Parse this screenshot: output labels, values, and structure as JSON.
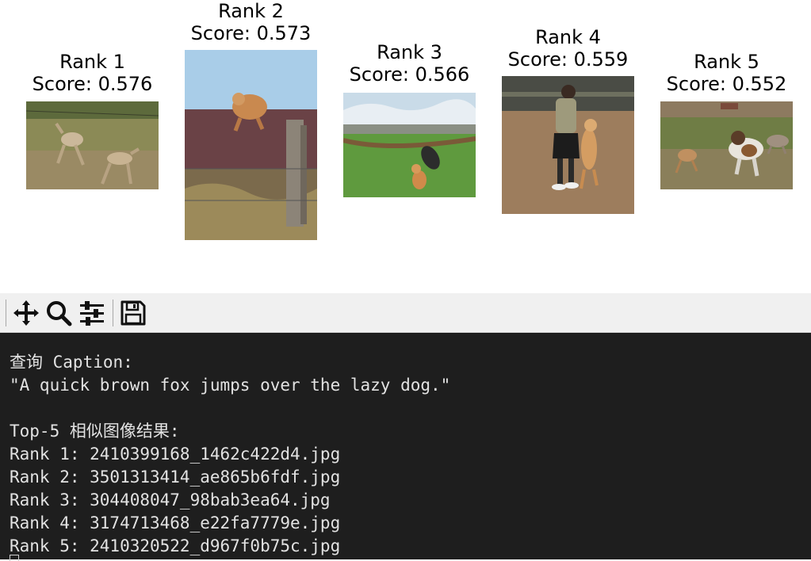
{
  "results": [
    {
      "rank_label": "Rank 1",
      "score_label": "Score: 0.576"
    },
    {
      "rank_label": "Rank 2",
      "score_label": "Score: 0.573"
    },
    {
      "rank_label": "Rank 3",
      "score_label": "Score: 0.566"
    },
    {
      "rank_label": "Rank 4",
      "score_label": "Score: 0.559"
    },
    {
      "rank_label": "Rank 5",
      "score_label": "Score: 0.552"
    }
  ],
  "toolbar": {
    "buttons": [
      {
        "icon": "move-icon"
      },
      {
        "icon": "zoom-icon"
      },
      {
        "icon": "sliders-icon"
      },
      {
        "icon": "save-icon"
      }
    ]
  },
  "console": {
    "query_header": "查询 Caption:",
    "query_text": "\"A quick brown fox jumps over the lazy dog.\"",
    "results_header": "Top-5 相似图像结果:",
    "result_lines": [
      "Rank 1: 2410399168_1462c422d4.jpg",
      "Rank 2: 3501313414_ae865b6fdf.jpg",
      "Rank 3: 304408047_98bab3ea64.jpg",
      "Rank 4: 3174713468_e22fa7779e.jpg",
      "Rank 5: 2410320522_d967f0b75c.jpg"
    ]
  },
  "colors": {
    "console_bg": "#1e1e1e",
    "console_text": "#e2e2e2",
    "toolbar_bg": "#f0f0f0"
  }
}
